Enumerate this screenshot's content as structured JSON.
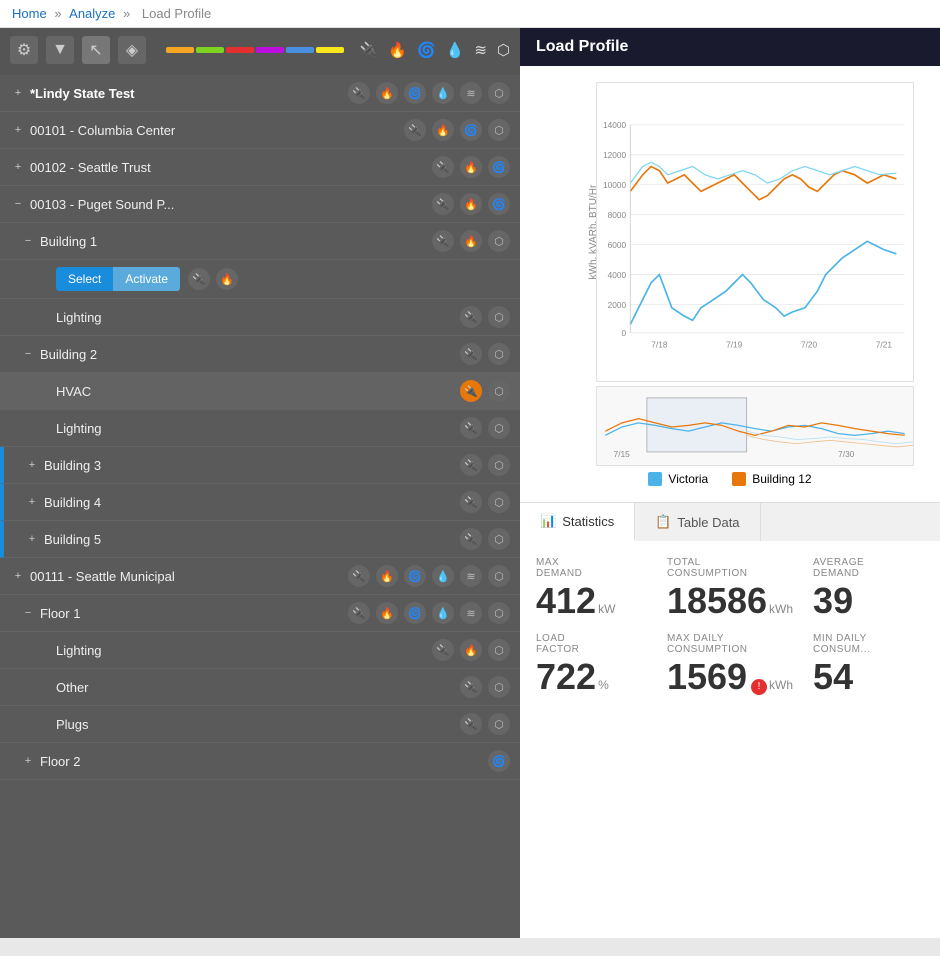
{
  "breadcrumb": {
    "home": "Home",
    "analyze": "Analyze",
    "page": "Load Profile"
  },
  "toolbar": {
    "icons": [
      "gear",
      "filter",
      "cursor",
      "tag"
    ],
    "color_bars": [
      "#f5a623",
      "#7ed321",
      "#e53030",
      "#bd10e0",
      "#4a90e2",
      "#f8e71c"
    ]
  },
  "panel_header": "Load Profile",
  "tree": {
    "items": [
      {
        "id": "lindy",
        "label": "*Lindy State Test",
        "indent": 0,
        "expand": "+",
        "bold": true,
        "icons": [
          "elec",
          "flame",
          "hvac",
          "fan",
          "misc",
          "cube"
        ]
      },
      {
        "id": "columbia",
        "label": "00101 - Columbia Center",
        "indent": 0,
        "expand": "+",
        "bold": false,
        "icons": [
          "elec",
          "flame",
          "hvac",
          "cube"
        ]
      },
      {
        "id": "seattle-trust",
        "label": "00102 - Seattle Trust",
        "indent": 0,
        "expand": "+",
        "bold": false,
        "icons": [
          "elec",
          "flame",
          "hvac"
        ]
      },
      {
        "id": "puget",
        "label": "00103 - Puget Sound P...",
        "indent": 0,
        "expand": "-",
        "bold": false,
        "icons": [
          "elec",
          "flame",
          "hvac"
        ]
      },
      {
        "id": "building1",
        "label": "Building 1",
        "indent": 1,
        "expand": "-",
        "bold": false,
        "icons": [
          "elec",
          "flame",
          "cube"
        ]
      },
      {
        "id": "building1-select",
        "label": "",
        "indent": 2,
        "special": "select-activate",
        "icons": [
          "elec",
          "flame"
        ]
      },
      {
        "id": "lighting1",
        "label": "Lighting",
        "indent": 2,
        "expand": "",
        "bold": false,
        "icons": [
          "elec",
          "cube"
        ]
      },
      {
        "id": "building2",
        "label": "Building 2",
        "indent": 1,
        "expand": "-",
        "bold": false,
        "icons": [
          "elec",
          "cube"
        ]
      },
      {
        "id": "hvac",
        "label": "HVAC",
        "indent": 2,
        "expand": "",
        "bold": false,
        "icons": [
          "elec-orange",
          "cube"
        ],
        "selected": true
      },
      {
        "id": "lighting2",
        "label": "Lighting",
        "indent": 2,
        "expand": "",
        "bold": false,
        "icons": [
          "elec",
          "cube"
        ]
      },
      {
        "id": "building3",
        "label": "Building 3",
        "indent": 1,
        "expand": "+",
        "bold": false,
        "icons": [
          "elec",
          "cube"
        ]
      },
      {
        "id": "building4",
        "label": "Building 4",
        "indent": 1,
        "expand": "+",
        "bold": false,
        "icons": [
          "elec",
          "cube"
        ]
      },
      {
        "id": "building5",
        "label": "Building 5",
        "indent": 1,
        "expand": "+",
        "bold": false,
        "icons": [
          "elec",
          "cube"
        ]
      },
      {
        "id": "seattle-muni",
        "label": "00111 - Seattle Municipal",
        "indent": 0,
        "expand": "+",
        "bold": false,
        "icons": [
          "elec",
          "flame",
          "hvac",
          "fan",
          "misc",
          "cube"
        ]
      },
      {
        "id": "floor1",
        "label": "Floor 1",
        "indent": 1,
        "expand": "-",
        "bold": false,
        "icons": [
          "elec",
          "flame",
          "hvac",
          "fan",
          "misc",
          "cube"
        ]
      },
      {
        "id": "lighting3",
        "label": "Lighting",
        "indent": 2,
        "expand": "",
        "bold": false,
        "icons": [
          "elec",
          "flame",
          "cube"
        ]
      },
      {
        "id": "other",
        "label": "Other",
        "indent": 2,
        "expand": "",
        "bold": false,
        "icons": [
          "elec",
          "cube"
        ]
      },
      {
        "id": "plugs",
        "label": "Plugs",
        "indent": 2,
        "expand": "",
        "bold": false,
        "icons": [
          "elec",
          "cube"
        ]
      },
      {
        "id": "floor2",
        "label": "Floor 2",
        "indent": 1,
        "expand": "+",
        "bold": false,
        "icons": [
          "hvac"
        ]
      }
    ]
  },
  "buttons": {
    "select": "Select",
    "activate": "Activate"
  },
  "chart": {
    "y_axis_label": "kWh, kVARh, BTU/Hr",
    "y_ticks": [
      0,
      2000,
      4000,
      6000,
      8000,
      10000,
      12000,
      14000
    ],
    "x_ticks_main": [
      "7/18",
      "7/19",
      "7/20",
      "7/21"
    ],
    "x_ticks_mini": [
      "7/15",
      "7/30"
    ]
  },
  "legend": {
    "items": [
      {
        "label": "Victoria",
        "color": "#4ab3e8"
      },
      {
        "label": "Building 12",
        "color": "#e8770a"
      }
    ]
  },
  "tabs": {
    "statistics": "Statistics",
    "table_data": "Table Data"
  },
  "stats": [
    {
      "label": "MAX\nDEMAND",
      "value": "412",
      "unit": "kW",
      "alert": false
    },
    {
      "label": "TOTAL\nCONSUMPTION",
      "value": "18586",
      "unit": "kWh",
      "alert": false
    },
    {
      "label": "AVERAGE\nDEMAND",
      "value": "39",
      "unit": "",
      "alert": false,
      "partial": true
    },
    {
      "label": "LOAD\nFACTOR",
      "value": "722",
      "unit": "%",
      "alert": false
    },
    {
      "label": "MAX DAILY\nCONSUMPTION",
      "value": "1569",
      "unit": "kWh",
      "alert": true
    },
    {
      "label": "MIN DAILY\nCONSUM...",
      "value": "54",
      "unit": "",
      "alert": false,
      "partial": true
    }
  ]
}
